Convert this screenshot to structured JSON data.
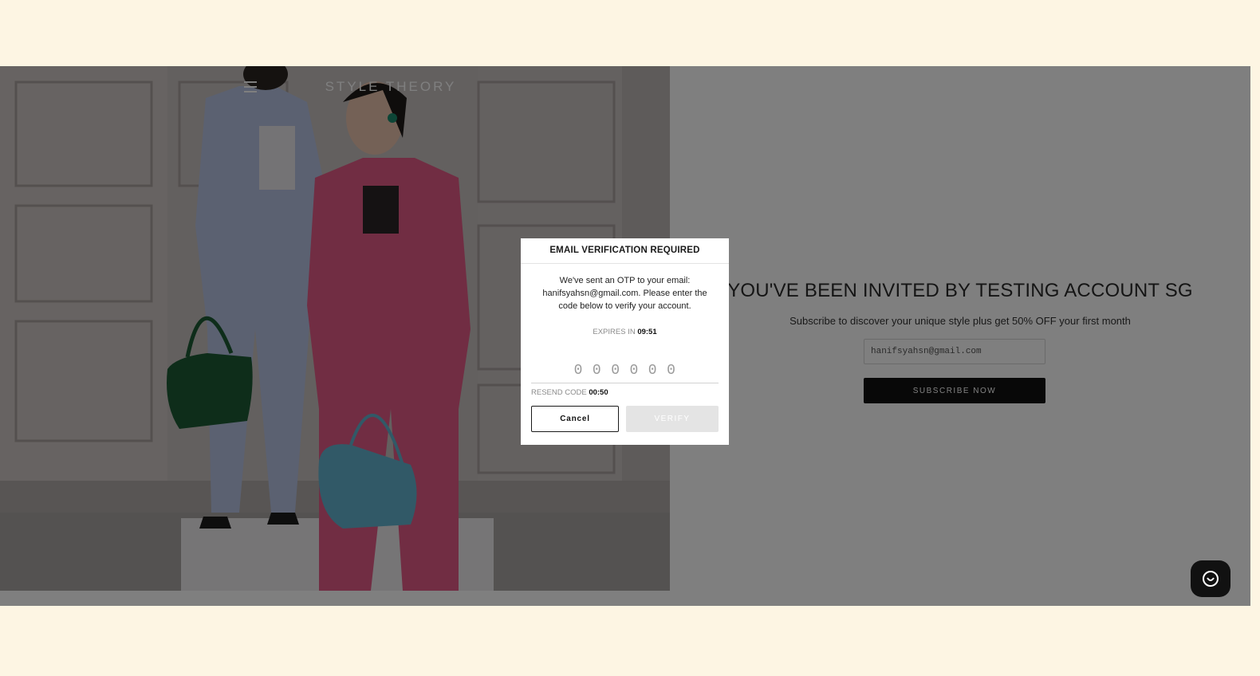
{
  "brand": {
    "logo_text": "STYLE THEORY"
  },
  "hero": {
    "image": "two models wearing blue and pink suits holding handbags in front of a wooden door"
  },
  "invite": {
    "heading": "YOU'VE BEEN INVITED BY TESTING ACCOUNT SG",
    "subtitle": "Subscribe to discover your unique style plus get 50% OFF your first month",
    "email_value": "hanifsyahsn@gmail.com",
    "subscribe_label": "SUBSCRIBE NOW"
  },
  "modal": {
    "title": "EMAIL VERIFICATION REQUIRED",
    "message": "We've sent an OTP to your email: hanifsyahsn@gmail.com. Please enter the code below to verify your account.",
    "expires_label": "EXPIRES IN",
    "expires_time": "09:51",
    "otp_placeholder": "000000",
    "resend_label": "RESEND CODE",
    "resend_time": "00:50",
    "cancel_label": "Cancel",
    "verify_label": "VERIFY"
  },
  "icons": {
    "menu": "hamburger-menu-icon",
    "chat": "chat-icon"
  },
  "colors": {
    "page_background": "#fdf5e3",
    "button_dark": "#111111",
    "verify_disabled": "#e4e4e4"
  }
}
